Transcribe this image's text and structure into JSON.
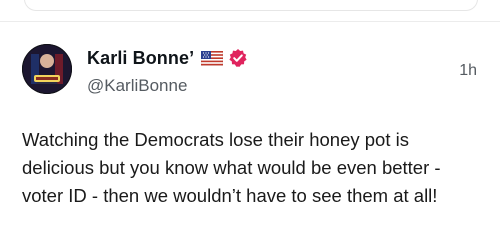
{
  "post": {
    "author_name": "Karli Bonne’",
    "author_handle": "@KarliBonne",
    "timestamp": "1h",
    "flag_icon": "us-flag-icon",
    "verified_icon": "verified-badge-icon",
    "verified_color": "#e0245e",
    "text": "Watching the Democrats lose their honey pot is delicious but you know what would be even better - voter ID - then we wouldn’t have to see them at all!"
  }
}
